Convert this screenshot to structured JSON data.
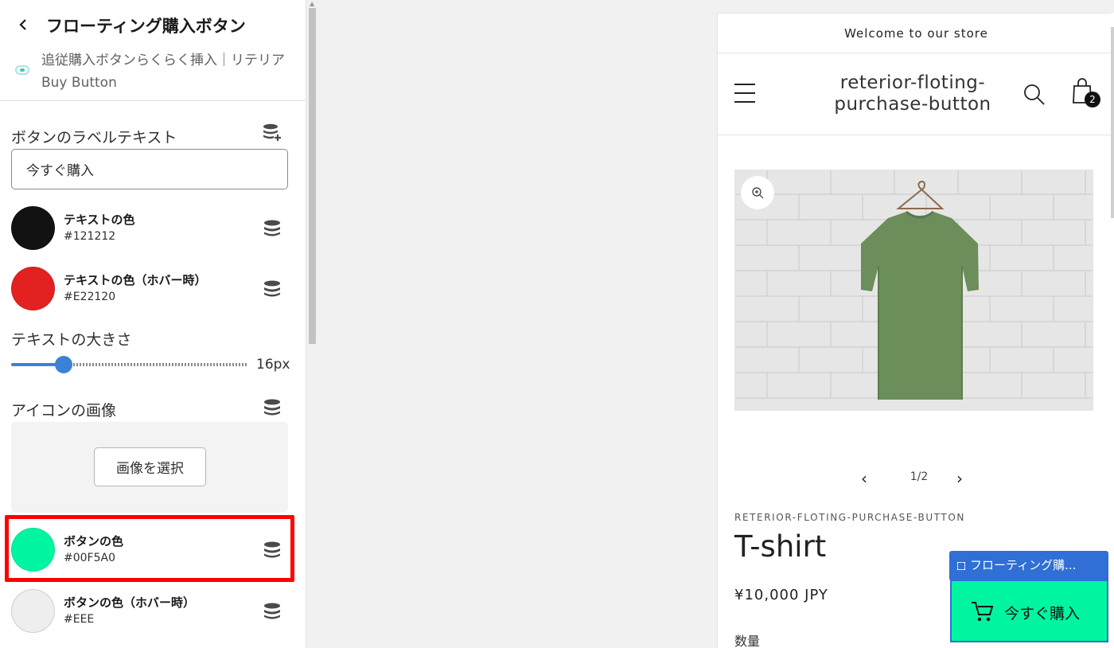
{
  "panel": {
    "title": "フローティング購入ボタン",
    "app_name": "追従購入ボタンらくらく挿入｜リテリア Buy Button",
    "label_text_label": "ボタンのラベルテキスト",
    "label_text_value": "今すぐ購入",
    "text_color": {
      "name": "テキストの色",
      "hex": "#121212",
      "color": "#121212"
    },
    "text_hover_color": {
      "name": "テキストの色（ホバー時）",
      "hex": "#E22120",
      "color": "#E22120"
    },
    "text_size_label": "テキストの大きさ",
    "text_size_value": "16px",
    "icon_image_label": "アイコンの画像",
    "select_image_label": "画像を選択",
    "button_color": {
      "name": "ボタンの色",
      "hex": "#00F5A0",
      "color": "#00F5A0"
    },
    "button_hover_color": {
      "name": "ボタンの色（ホバー時）",
      "hex": "#EEE",
      "color": "#EEEEEE"
    }
  },
  "preview": {
    "announcement": "Welcome to our store",
    "store_title": "reterior-floting-purchase-button",
    "cart_count": "2",
    "pager": "1/2",
    "vendor": "RETERIOR-FLOTING-PURCHASE-BUTTON",
    "product_title": "T-shirt",
    "price": "¥10,000 JPY",
    "quantity_label": "数量",
    "floating_tab_label": "フローティング購...",
    "floating_button_label": "今すぐ購入"
  },
  "colors": {
    "accent": "#3B82D6",
    "highlight": "#FF0000",
    "selected_outline": "#2F6FD6"
  }
}
